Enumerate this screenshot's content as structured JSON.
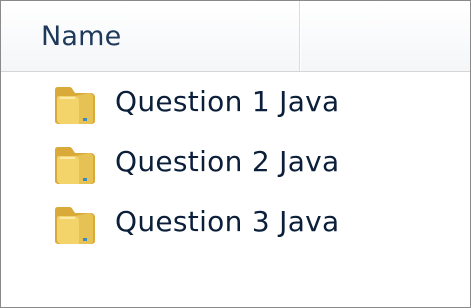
{
  "columns": {
    "name_label": "Name"
  },
  "items": [
    {
      "label": "Question 1 Java",
      "icon": "folder-icon"
    },
    {
      "label": "Question 2 Java",
      "icon": "folder-icon"
    },
    {
      "label": "Question 3 Java",
      "icon": "folder-icon"
    }
  ],
  "colors": {
    "header_text": "#1e395b",
    "item_text": "#0b1f3a",
    "folder_front": "#f3d46b",
    "folder_back": "#d9a93a"
  }
}
